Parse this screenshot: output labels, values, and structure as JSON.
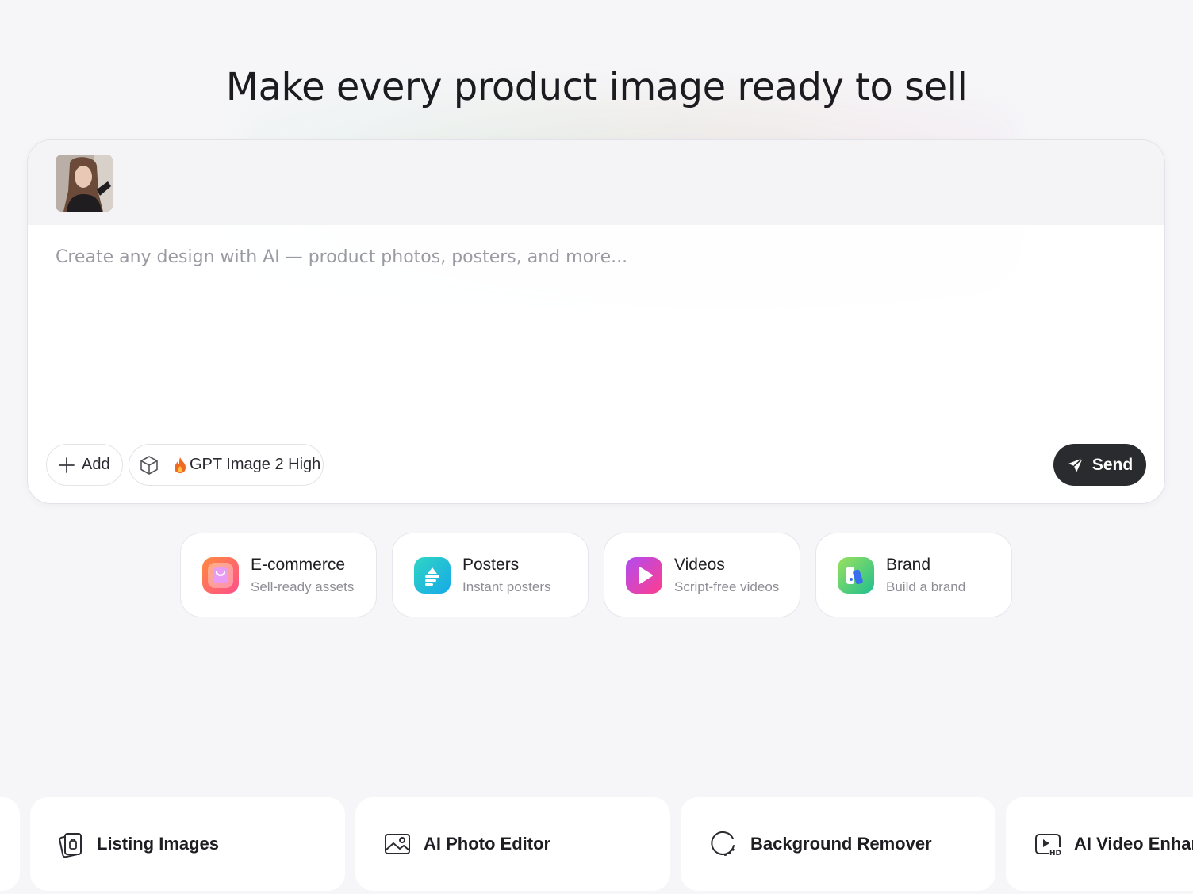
{
  "hero": {
    "title": "Make every product image ready to sell"
  },
  "composer": {
    "placeholder": "Create any design with AI — product photos, posters, and more...",
    "add_label": "Add",
    "model_label": "GPT Image 2 High",
    "send_label": "Send",
    "send_color": "#2a2b2e"
  },
  "categories": [
    {
      "title": "E-commerce",
      "subtitle": "Sell-ready assets",
      "icon": "shopping-bag-icon"
    },
    {
      "title": "Posters",
      "subtitle": "Instant posters",
      "icon": "poster-icon"
    },
    {
      "title": "Videos",
      "subtitle": "Script-free videos",
      "icon": "play-icon"
    },
    {
      "title": "Brand",
      "subtitle": "Build a brand",
      "icon": "brand-icon"
    }
  ],
  "tools": [
    {
      "label": "",
      "icon": ""
    },
    {
      "label": "Listing Images",
      "icon": "listing-images-icon"
    },
    {
      "label": "AI Photo Editor",
      "icon": "image-icon"
    },
    {
      "label": "Background Remover",
      "icon": "background-remover-icon"
    },
    {
      "label": "AI Video Enhancer",
      "icon": "video-hd-icon"
    }
  ]
}
